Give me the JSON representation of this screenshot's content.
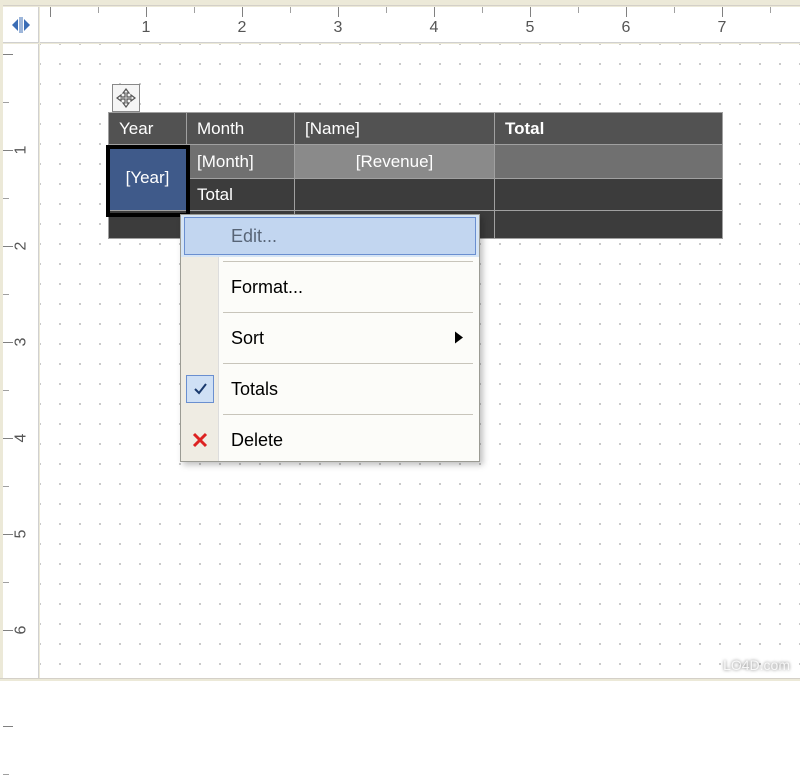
{
  "ruler": {
    "h_labels": [
      "1",
      "2",
      "3",
      "4",
      "5",
      "6",
      "7"
    ],
    "v_labels": [
      "1",
      "2",
      "3",
      "4",
      "5",
      "6"
    ]
  },
  "table": {
    "headers": {
      "year": "Year",
      "month": "Month",
      "name": "[Name]",
      "total": "Total"
    },
    "row2": {
      "year": "[Year]",
      "month": "[Month]",
      "revenue": "[Revenue]"
    },
    "row3": {
      "total_label": "Total"
    }
  },
  "context_menu": {
    "edit": "Edit...",
    "format": "Format...",
    "sort": "Sort",
    "totals": "Totals",
    "delete": "Delete"
  },
  "watermark": "LO4D.com"
}
